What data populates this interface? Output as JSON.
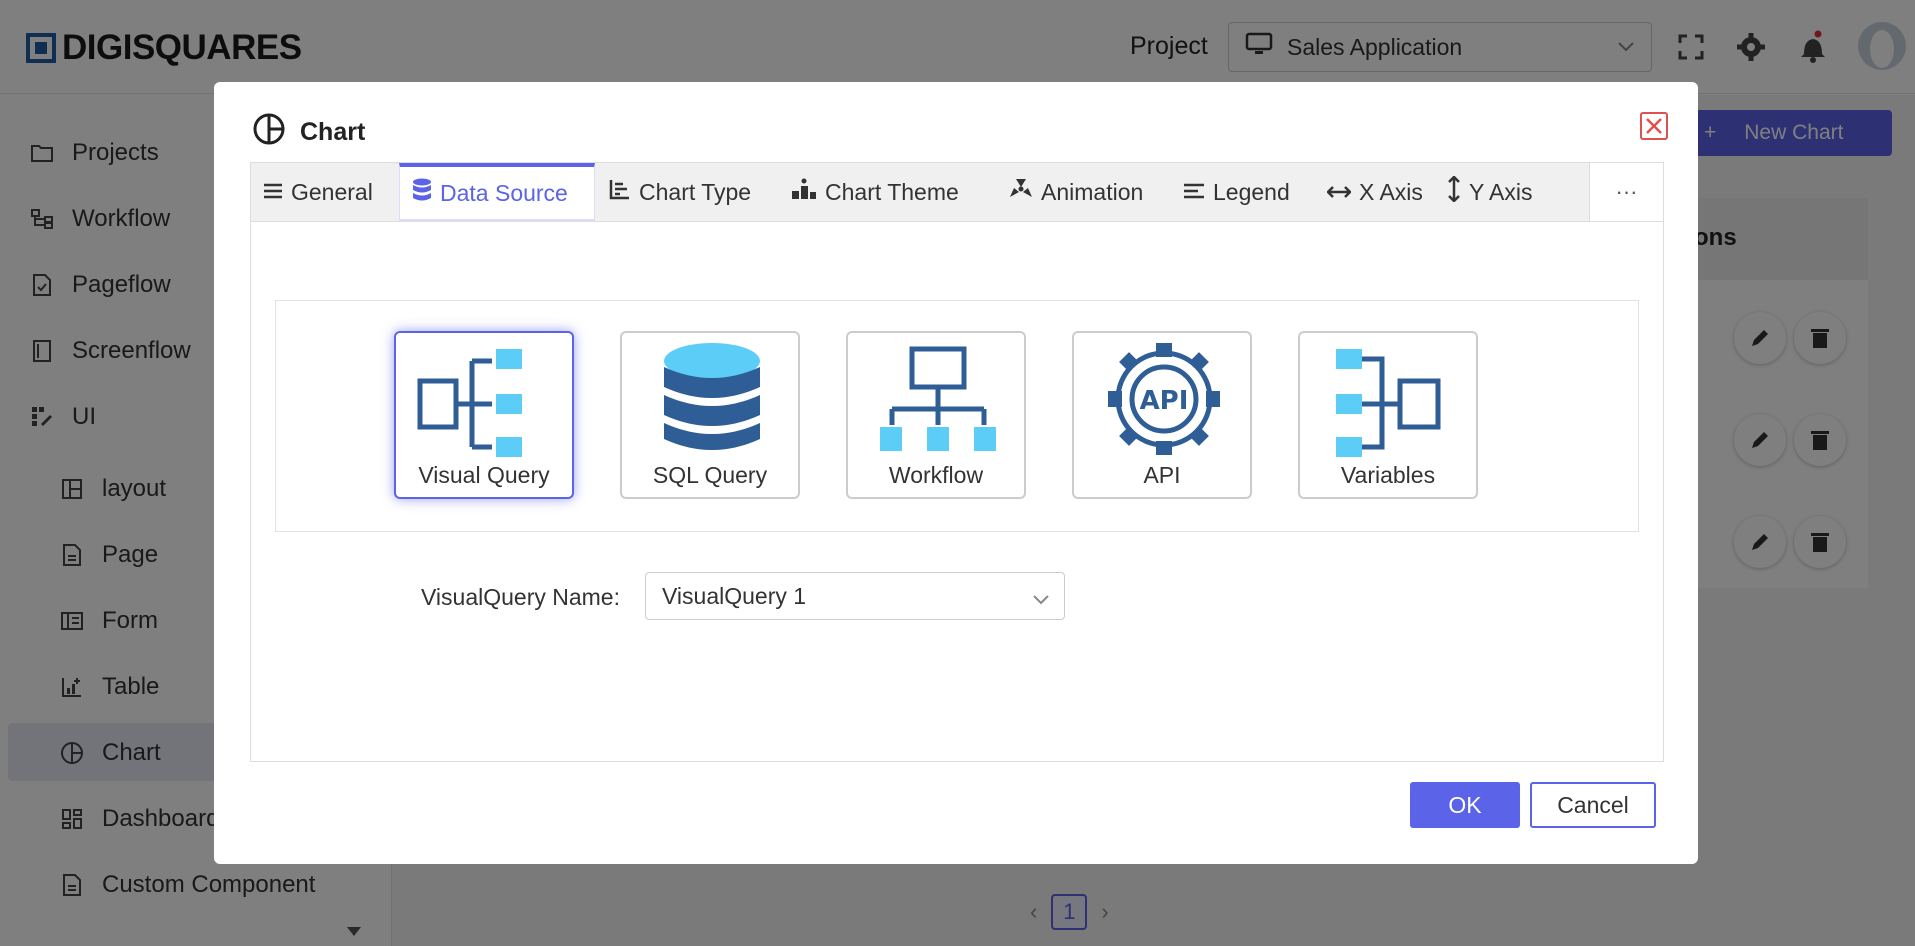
{
  "app": {
    "logo_text": "DIGISQUARES",
    "project_label": "Project",
    "project_value": "Sales Application"
  },
  "sidebar": {
    "items": [
      {
        "label": "Projects",
        "icon": "folder-icon"
      },
      {
        "label": "Workflow",
        "icon": "workflow-icon"
      },
      {
        "label": "Pageflow",
        "icon": "pageflow-icon"
      },
      {
        "label": "Screenflow",
        "icon": "screenflow-icon"
      },
      {
        "label": "UI",
        "icon": "ui-icon"
      },
      {
        "label": "layout",
        "icon": "layout-icon"
      },
      {
        "label": "Page",
        "icon": "page-icon"
      },
      {
        "label": "Form",
        "icon": "form-icon"
      },
      {
        "label": "Table",
        "icon": "table-icon"
      },
      {
        "label": "Chart",
        "icon": "chart-icon"
      },
      {
        "label": "Dashboard",
        "icon": "dashboard-icon"
      },
      {
        "label": "Custom Component",
        "icon": "custom-component-icon"
      }
    ]
  },
  "main": {
    "new_chart_label": "New Chart",
    "table_header": "ons",
    "pager_page": "1"
  },
  "modal": {
    "title": "Chart",
    "tabs": [
      {
        "label": "General",
        "icon": "menu-icon"
      },
      {
        "label": "Data Source",
        "icon": "database-icon"
      },
      {
        "label": "Chart Type",
        "icon": "bar-chart-icon"
      },
      {
        "label": "Chart Theme",
        "icon": "theme-icon"
      },
      {
        "label": "Animation",
        "icon": "animation-icon"
      },
      {
        "label": "Legend",
        "icon": "legend-icon"
      },
      {
        "label": "X Axis",
        "icon": "horizontal-arrows-icon"
      },
      {
        "label": "Y Axis",
        "icon": "vertical-arrows-icon"
      }
    ],
    "active_tab": "Data Source",
    "more_label": "···",
    "sources": [
      {
        "label": "Visual Query",
        "icon": "visual-query-icon",
        "selected": true
      },
      {
        "label": "SQL Query",
        "icon": "sql-database-icon",
        "selected": false
      },
      {
        "label": "Workflow",
        "icon": "workflow-tree-icon",
        "selected": false
      },
      {
        "label": "API",
        "icon": "api-gear-icon",
        "selected": false
      },
      {
        "label": "Variables",
        "icon": "variables-icon",
        "selected": false
      }
    ],
    "vq_name_label": "VisualQuery Name:",
    "vq_name_value": "VisualQuery 1",
    "ok_label": "OK",
    "cancel_label": "Cancel"
  },
  "colors": {
    "accent": "#5b63e8",
    "icon_dark": "#2f5d96",
    "icon_light": "#5ccdf7",
    "close_red": "#e05050"
  }
}
